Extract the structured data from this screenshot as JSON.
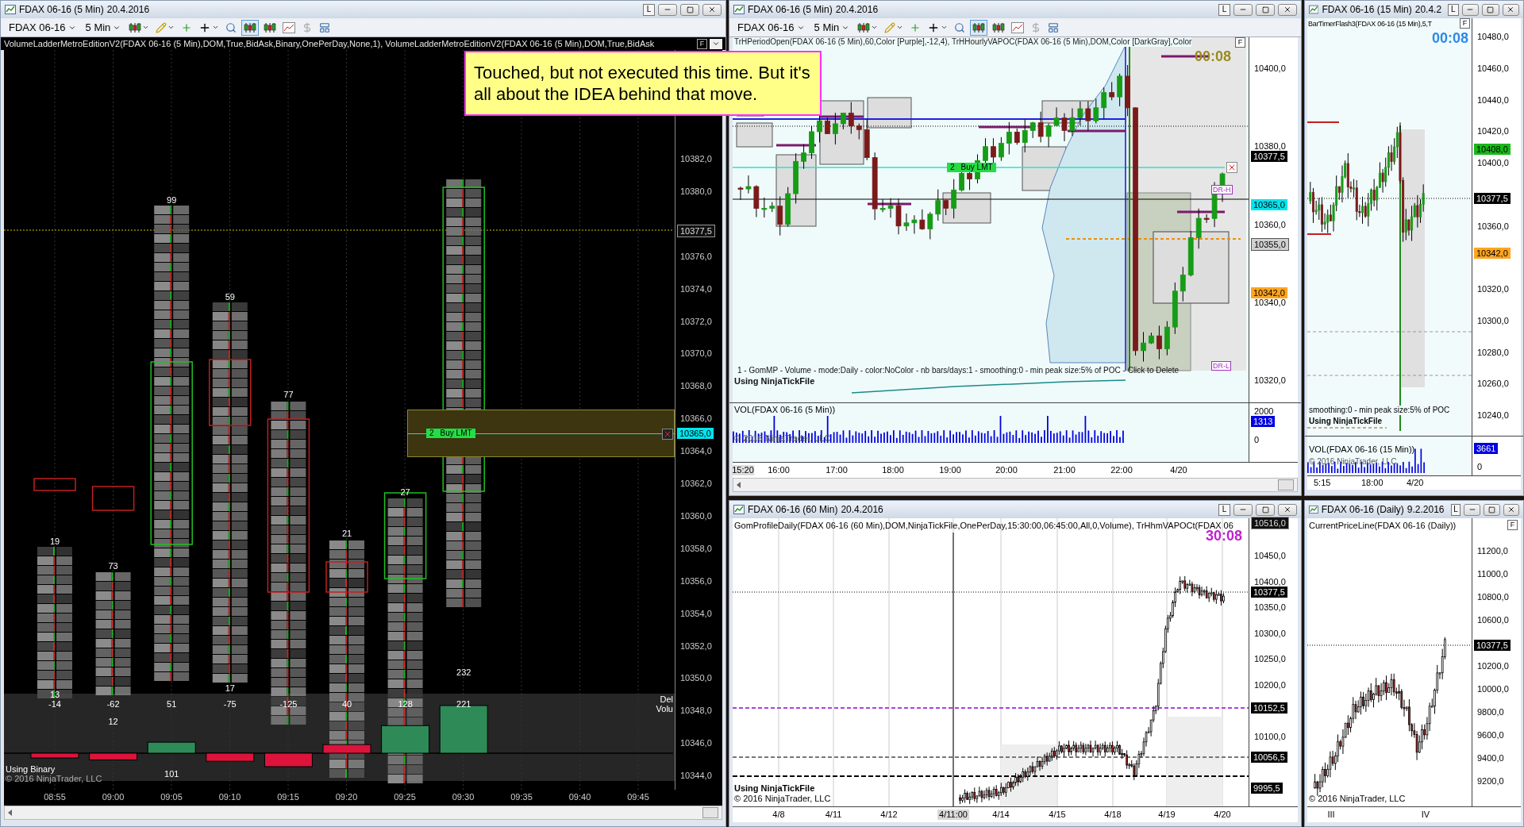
{
  "annotation": "Touched, but not executed this time. But it's all about the IDEA behind that move.",
  "left_window": {
    "title": "FDAX 06-16 (5 Min)",
    "date": "20.4.2016",
    "pin": "L",
    "toolbar": {
      "instrument": "FDAX 06-16",
      "interval": "5 Min"
    },
    "indicator": "VolumeLadderMetroEditionV2(FDAX 06-16 (5 Min),DOM,True,BidAsk,Binary,OnePerDay,None,1), VolumeLadderMetroEditionV2(FDAX 06-16 (5 Min),DOM,True,BidAsk",
    "panel_button": "F",
    "price_axis": [
      "10382,0",
      "10380,0",
      "10376,0",
      "10374,0",
      "10372,0",
      "10370,0",
      "10368,0",
      "10366,0",
      "10364,0",
      "10362,0",
      "10360,0",
      "10358,0",
      "10356,0",
      "10354,0",
      "10352,0",
      "10350,0",
      "10348,0",
      "10346,0",
      "10344,0"
    ],
    "price_tags": [
      {
        "text": "10377,5",
        "kind": "outline"
      },
      {
        "text": "10365,0",
        "kind": "order"
      }
    ],
    "columns": [
      {
        "total": "19",
        "delta": "-14",
        "sub": "13",
        "color": "#dc143c"
      },
      {
        "total": "73",
        "delta": "-62",
        "sub": "12",
        "color": "#dc143c"
      },
      {
        "total": "99",
        "delta": "51",
        "sub": "101",
        "color": "#2e8b57"
      },
      {
        "total": "59",
        "delta": "-75",
        "sub": "17",
        "color": "#dc143c"
      },
      {
        "total": "77",
        "delta": "-125",
        "color": "#dc143c"
      },
      {
        "total": "21",
        "delta": "40",
        "color": "#dc143c"
      },
      {
        "total": "27",
        "delta": "128",
        "color": "#2e8b57"
      },
      {
        "total": "232",
        "delta": "221",
        "color": "#2e8b57"
      }
    ],
    "order": {
      "quantity": "2",
      "label": "Buy LMT"
    },
    "delta_label": [
      "Del",
      "Volu"
    ],
    "footer": [
      "Using Binary",
      "© 2016 NinjaTrader, LLC"
    ],
    "time_axis": [
      "08:55",
      "09:00",
      "09:05",
      "09:10",
      "09:15",
      "09:20",
      "09:25",
      "09:30",
      "09:35",
      "09:40",
      "09:45"
    ]
  },
  "mid_window": {
    "title": "FDAX 06-16 (5 Min)",
    "date": "20.4.2016",
    "pin": "L",
    "toolbar": {
      "instrument": "FDAX 06-16",
      "interval": "5 Min"
    },
    "indicator": "TrHPeriodOpen(FDAX 06-16 (5 Min),60,Color [Purple],-12,4), TrHHourlyVAPOC(FDAX 06-16 (5 Min),DOM,Color [DarkGray],Color",
    "panel_button": "F",
    "timer": "00:08",
    "price_axis": [
      "10400,0",
      "10380,0",
      "10360,0",
      "10340,0",
      "10320,0"
    ],
    "price_tags": [
      {
        "text": "10377,5",
        "kind": "last"
      },
      {
        "text": "10365,0",
        "kind": "order"
      },
      {
        "text": "10355,0",
        "kind": "level"
      },
      {
        "text": "10342,0",
        "kind": "vwap"
      }
    ],
    "order": {
      "quantity": "2",
      "label": "Buy LMT"
    },
    "labels": [
      "DR-H",
      "DR-L"
    ],
    "profile_note": "1 - GomMP - Volume - mode:Daily - color:NoColor - nb bars/days:1 - smoothing:0 - min peak size:5% of POC - Click to Delete",
    "source": "Using NinjaTickFile",
    "volume": {
      "title": "VOL(FDAX 06-16 (5 Min))",
      "axis": [
        "2000",
        "0"
      ],
      "tag": "1313",
      "copyright": "© 2016 NinjaTrader, LLC"
    },
    "time_axis": [
      "15:20",
      "16:00",
      "17:00",
      "18:00",
      "19:00",
      "20:00",
      "21:00",
      "22:00",
      "4/20"
    ]
  },
  "right_window": {
    "title": "FDAX 06-16 (15 Min)",
    "date": "20.4.2",
    "pin": "L",
    "indicator": "BarTimerFlash3(FDAX 06-16 (15 Min),5,T",
    "panel_button": "F",
    "timer": "00:08",
    "price_axis": [
      "10480,0",
      "10460,0",
      "10440,0",
      "10420,0",
      "10400,0",
      "10360,0",
      "10320,0",
      "10300,0",
      "10280,0",
      "10260,0",
      "10240,0"
    ],
    "price_tags": [
      {
        "text": "10408,0",
        "kind": "high"
      },
      {
        "text": "10377,5",
        "kind": "last"
      },
      {
        "text": "10342,0",
        "kind": "vwap"
      }
    ],
    "profile_note": "smoothing:0 - min peak size:5% of POC",
    "source": "Using NinjaTickFile",
    "volume": {
      "title": "VOL(FDAX 06-16 (15 Min))",
      "axis": [
        "0"
      ],
      "tag": "3661",
      "copyright": "© 2016 NinjaTrader, LLC"
    },
    "time_axis": [
      "5:15",
      "18:00",
      "4/20"
    ]
  },
  "hourly_window": {
    "title": "FDAX 06-16 (60 Min)",
    "date": "20.4.2016",
    "pin": "L",
    "indicator": "GomProfileDaily(FDAX 06-16 (60 Min),DOM,NinjaTickFile,OnePerDay,15:30:00,06:45:00,All,0,Volume), TrHhmVAPOCt(FDAX 06",
    "timer": "30:08",
    "price_axis": [
      "10450,0",
      "10400,0",
      "10350,0",
      "10300,0",
      "10250,0",
      "10200,0",
      "10100,0"
    ],
    "price_tags": [
      {
        "text": "10516,0",
        "kind": "outline"
      },
      {
        "text": "10377,5",
        "kind": "last"
      },
      {
        "text": "10152,5",
        "kind": "last"
      },
      {
        "text": "10056,5",
        "kind": "last"
      },
      {
        "text": "9995,5",
        "kind": "last"
      }
    ],
    "source": "Using NinjaTickFile",
    "copyright": "© 2016 NinjaTrader, LLC",
    "time_axis": [
      {
        "text": "4/8",
        "selected": false
      },
      {
        "text": "4/11",
        "selected": false
      },
      {
        "text": "4/12",
        "selected": false
      },
      {
        "text": "4/11:00",
        "selected": true
      },
      {
        "text": "4/14",
        "selected": false
      },
      {
        "text": "4/15",
        "selected": false
      },
      {
        "text": "4/18",
        "selected": false
      },
      {
        "text": "4/19",
        "selected": false
      },
      {
        "text": "4/20",
        "selected": false
      }
    ]
  },
  "daily_window": {
    "title": "FDAX 06-16 (Daily)",
    "date": "9.2.2016",
    "pin": "L",
    "indicator": "CurrentPriceLine(FDAX 06-16 (Daily))",
    "panel_button": "F",
    "price_axis": [
      "11200,0",
      "11000,0",
      "10800,0",
      "10600,0",
      "10200,0",
      "10000,0",
      "9800,0",
      "9600,0",
      "9400,0",
      "9200,0"
    ],
    "price_tags": [
      {
        "text": "10377,5",
        "kind": "last"
      }
    ],
    "copyright": "© 2016 NinjaTrader, LLC",
    "time_axis": [
      "III",
      "IV"
    ]
  }
}
